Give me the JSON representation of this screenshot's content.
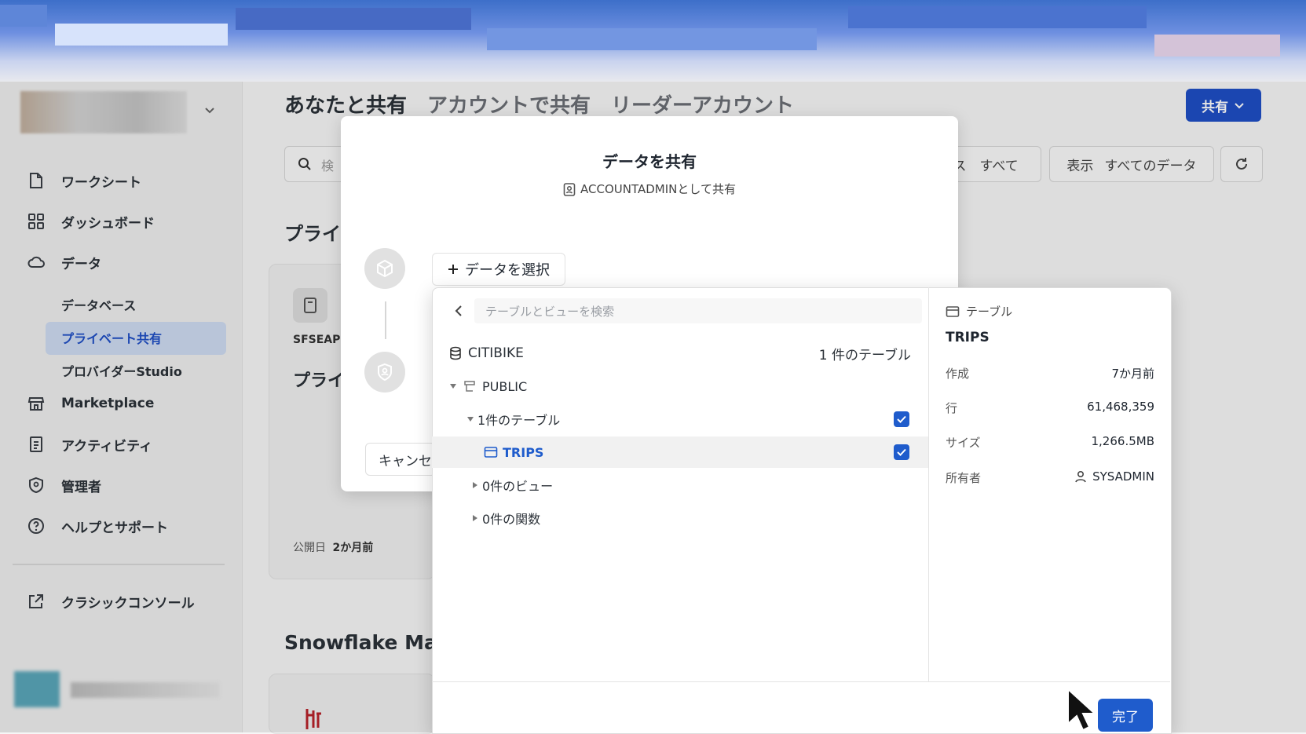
{
  "sidebar": {
    "nav": [
      {
        "label": "ワークシート",
        "icon": "document-icon"
      },
      {
        "label": "ダッシュボード",
        "icon": "grid-icon"
      },
      {
        "label": "データ",
        "icon": "cloud-icon"
      }
    ],
    "sub": [
      {
        "label": "データベース"
      },
      {
        "label": "プライベート共有"
      },
      {
        "label": "プロバイダーStudio"
      }
    ],
    "nav2": [
      {
        "label": "Marketplace",
        "icon": "store-icon"
      },
      {
        "label": "アクティビティ",
        "icon": "activity-icon"
      },
      {
        "label": "管理者",
        "icon": "shield-icon"
      },
      {
        "label": "ヘルプとサポート",
        "icon": "help-icon"
      }
    ],
    "classic": "クラシックコンソール"
  },
  "main": {
    "tabs": [
      "あなたと共有",
      "アカウントで共有",
      "リーダーアカウント"
    ],
    "share_button": "共有",
    "search_placeholder": "検",
    "filter_source": "ース　すべて",
    "filter_view_label": "表示",
    "filter_view_value": "すべてのデータ",
    "heading_private": "プライ",
    "card_label": "SFSEAP",
    "card_title": "プライ",
    "card_published_label": "公開日",
    "card_published_value": "2か月前",
    "heading_marketplace": "Snowflake Mar"
  },
  "modal": {
    "title": "データを共有",
    "subtitle": "ACCOUNTADMINとして共有",
    "select_data_button": "データを選択",
    "cancel_button": "キャンセ"
  },
  "picker": {
    "search_placeholder": "テーブルとビューを検索",
    "database": {
      "name": "CITIBIKE",
      "count": "1 件のテーブル"
    },
    "schema": "PUBLIC",
    "groups": {
      "tables": "1件のテーブル",
      "views": "0件のビュー",
      "functions": "0件の関数"
    },
    "selected_table": "TRIPS",
    "done_button": "完了"
  },
  "details": {
    "type": "テーブル",
    "name": "TRIPS",
    "rows": [
      {
        "label": "作成",
        "value": "7か月前"
      },
      {
        "label": "行",
        "value": "61,468,359"
      },
      {
        "label": "サイズ",
        "value": "1,266.5MB"
      },
      {
        "label": "所有者",
        "value": "SYSADMIN"
      }
    ]
  },
  "colors": {
    "accent": "#1f5ccc",
    "share_button": "#1f4fc6",
    "active_nav_bg": "#cfdcf2"
  }
}
